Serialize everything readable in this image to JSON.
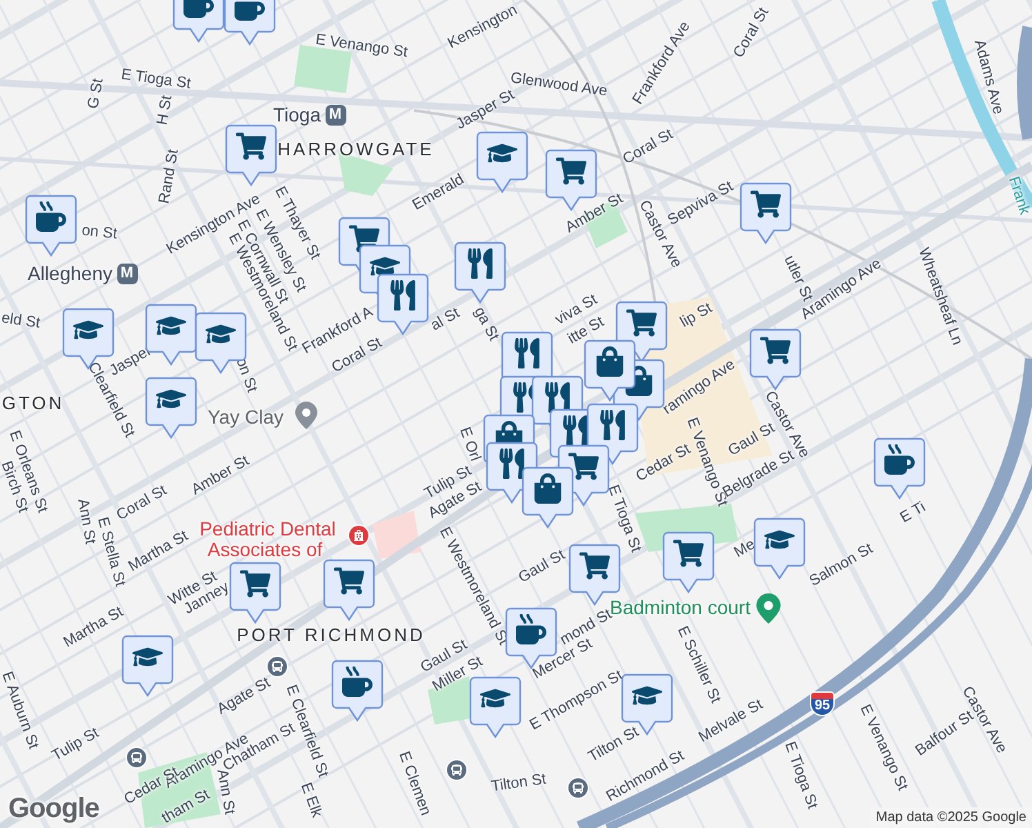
{
  "labels": [
    {
      "kind": "street",
      "text": "E Venango St"
    },
    {
      "kind": "street",
      "text": "Kensington"
    },
    {
      "kind": "street",
      "text": "E Tioga St"
    },
    {
      "kind": "street",
      "text": "Glenwood Ave"
    },
    {
      "kind": "street",
      "text": "Jasper St"
    },
    {
      "kind": "street",
      "text": "Coral St"
    },
    {
      "kind": "street",
      "text": "Frankford Ave"
    },
    {
      "kind": "street",
      "text": "Coral St"
    },
    {
      "kind": "street",
      "text": "G St"
    },
    {
      "kind": "street",
      "text": "H St"
    },
    {
      "kind": "street",
      "text": "Rand St"
    },
    {
      "kind": "station",
      "text": "Tioga",
      "badge": "M"
    },
    {
      "kind": "area",
      "text": "HARROWGATE"
    },
    {
      "kind": "street",
      "text": "Emerald"
    },
    {
      "kind": "street",
      "text": "Amber St"
    },
    {
      "kind": "street",
      "text": "Sepviva St"
    },
    {
      "kind": "street",
      "text": "Castor Ave"
    },
    {
      "kind": "street",
      "text": "utler St"
    },
    {
      "kind": "street",
      "text": "Aramingo Ave"
    },
    {
      "kind": "street",
      "text": "Wheatsheaf Ln"
    },
    {
      "kind": "street",
      "text": "Adams Ave"
    },
    {
      "kind": "water",
      "text": "Frank"
    },
    {
      "kind": "street",
      "text": "on St"
    },
    {
      "kind": "station",
      "text": "Allegheny",
      "badge": "M"
    },
    {
      "kind": "street",
      "text": "Kensington Ave"
    },
    {
      "kind": "street",
      "text": "E Thayer St"
    },
    {
      "kind": "street",
      "text": "E Wensley St"
    },
    {
      "kind": "street",
      "text": "E Cornwall St"
    },
    {
      "kind": "street",
      "text": "E Westmoreland St"
    },
    {
      "kind": "street",
      "text": "Frankford A"
    },
    {
      "kind": "street",
      "text": "Coral St"
    },
    {
      "kind": "street",
      "text": "al St"
    },
    {
      "kind": "street",
      "text": "ga St"
    },
    {
      "kind": "street",
      "text": "eld St"
    },
    {
      "kind": "street",
      "text": "Jasper"
    },
    {
      "kind": "street",
      "text": "on St"
    },
    {
      "kind": "street",
      "text": "Clearfield St"
    },
    {
      "kind": "area",
      "text": "GTON"
    },
    {
      "kind": "place",
      "text": "Yay Clay"
    },
    {
      "kind": "street",
      "text": "E Orleans St"
    },
    {
      "kind": "street",
      "text": "Birch St"
    },
    {
      "kind": "street",
      "text": "Coral St"
    },
    {
      "kind": "street",
      "text": "Amber St"
    },
    {
      "kind": "street",
      "text": "Ann St"
    },
    {
      "kind": "street",
      "text": "E Stella St"
    },
    {
      "kind": "street",
      "text": "Martha St"
    },
    {
      "kind": "street",
      "text": "Martha St"
    },
    {
      "kind": "street",
      "text": "Witte St"
    },
    {
      "kind": "street",
      "text": "Janney"
    },
    {
      "kind": "medical",
      "text": "Pediatric Dental"
    },
    {
      "kind": "medical",
      "text": "Associates of"
    },
    {
      "kind": "area",
      "text": "PORT RICHMOND"
    },
    {
      "kind": "street",
      "text": "E Westmoreland St"
    },
    {
      "kind": "street",
      "text": "Agate St"
    },
    {
      "kind": "street",
      "text": "Aramingo Ave"
    },
    {
      "kind": "street",
      "text": "Tulip St"
    },
    {
      "kind": "street",
      "text": "Chatham St"
    },
    {
      "kind": "street",
      "text": "E Clearfield St"
    },
    {
      "kind": "street",
      "text": "Ann St"
    },
    {
      "kind": "street",
      "text": "Cedar St"
    },
    {
      "kind": "street",
      "text": "tham St"
    },
    {
      "kind": "street",
      "text": "E Elk"
    },
    {
      "kind": "street",
      "text": "E Clemen"
    },
    {
      "kind": "street",
      "text": "Gaul St"
    },
    {
      "kind": "street",
      "text": "Miller St"
    },
    {
      "kind": "street",
      "text": "E Auburn St"
    },
    {
      "kind": "street",
      "text": "Tilton St"
    },
    {
      "kind": "street",
      "text": "Tilton St"
    },
    {
      "kind": "street",
      "text": "Richmond St"
    },
    {
      "kind": "street",
      "text": "Melvale St"
    },
    {
      "kind": "street",
      "text": "E Tioga St"
    },
    {
      "kind": "street",
      "text": "E Venango St"
    },
    {
      "kind": "street",
      "text": "Balfour St"
    },
    {
      "kind": "street",
      "text": "Castor Ave"
    },
    {
      "kind": "street",
      "text": "Salmon St"
    },
    {
      "kind": "park",
      "text": "Badminton court"
    },
    {
      "kind": "street",
      "text": "Me"
    },
    {
      "kind": "street",
      "text": "E Schiller St"
    },
    {
      "kind": "street",
      "text": "Mercer St"
    },
    {
      "kind": "street",
      "text": "E Thompson St"
    },
    {
      "kind": "street",
      "text": "mond St"
    },
    {
      "kind": "street",
      "text": "Gaul St"
    },
    {
      "kind": "street",
      "text": "E Tioga St"
    },
    {
      "kind": "street",
      "text": "Cedar St"
    },
    {
      "kind": "street",
      "text": "E Venango St"
    },
    {
      "kind": "street",
      "text": "Gaul St"
    },
    {
      "kind": "street",
      "text": "Belgrade St"
    },
    {
      "kind": "street",
      "text": "Castor Ave"
    },
    {
      "kind": "street",
      "text": "E Ti"
    },
    {
      "kind": "street",
      "text": "Tulip St"
    },
    {
      "kind": "street",
      "text": "Agate St"
    },
    {
      "kind": "street",
      "text": "E Orl"
    },
    {
      "kind": "street",
      "text": "viva St"
    },
    {
      "kind": "street",
      "text": "itte St"
    },
    {
      "kind": "street",
      "text": "lip St"
    },
    {
      "kind": "street",
      "text": "ramingo Ave"
    },
    {
      "kind": "shield",
      "text": "95"
    }
  ],
  "markers": [
    {
      "kind": "cup"
    },
    {
      "kind": "cup"
    },
    {
      "kind": "cart"
    },
    {
      "kind": "school"
    },
    {
      "kind": "cart"
    },
    {
      "kind": "cart"
    },
    {
      "kind": "cup"
    },
    {
      "kind": "cart"
    },
    {
      "kind": "school"
    },
    {
      "kind": "food"
    },
    {
      "kind": "food"
    },
    {
      "kind": "school"
    },
    {
      "kind": "school"
    },
    {
      "kind": "school"
    },
    {
      "kind": "school"
    },
    {
      "kind": "food"
    },
    {
      "kind": "cart"
    },
    {
      "kind": "bag"
    },
    {
      "kind": "bag"
    },
    {
      "kind": "food"
    },
    {
      "kind": "food"
    },
    {
      "kind": "food"
    },
    {
      "kind": "food"
    },
    {
      "kind": "bag"
    },
    {
      "kind": "food"
    },
    {
      "kind": "cart"
    },
    {
      "kind": "bag"
    },
    {
      "kind": "cart"
    },
    {
      "kind": "cart"
    },
    {
      "kind": "cart"
    },
    {
      "kind": "cup"
    },
    {
      "kind": "cart"
    },
    {
      "kind": "school"
    },
    {
      "kind": "cart"
    },
    {
      "kind": "school"
    },
    {
      "kind": "cup"
    },
    {
      "kind": "cup"
    },
    {
      "kind": "school"
    },
    {
      "kind": "school"
    }
  ],
  "footer": {
    "logo": "Google",
    "attribution": "Map data ©2025 Google"
  }
}
